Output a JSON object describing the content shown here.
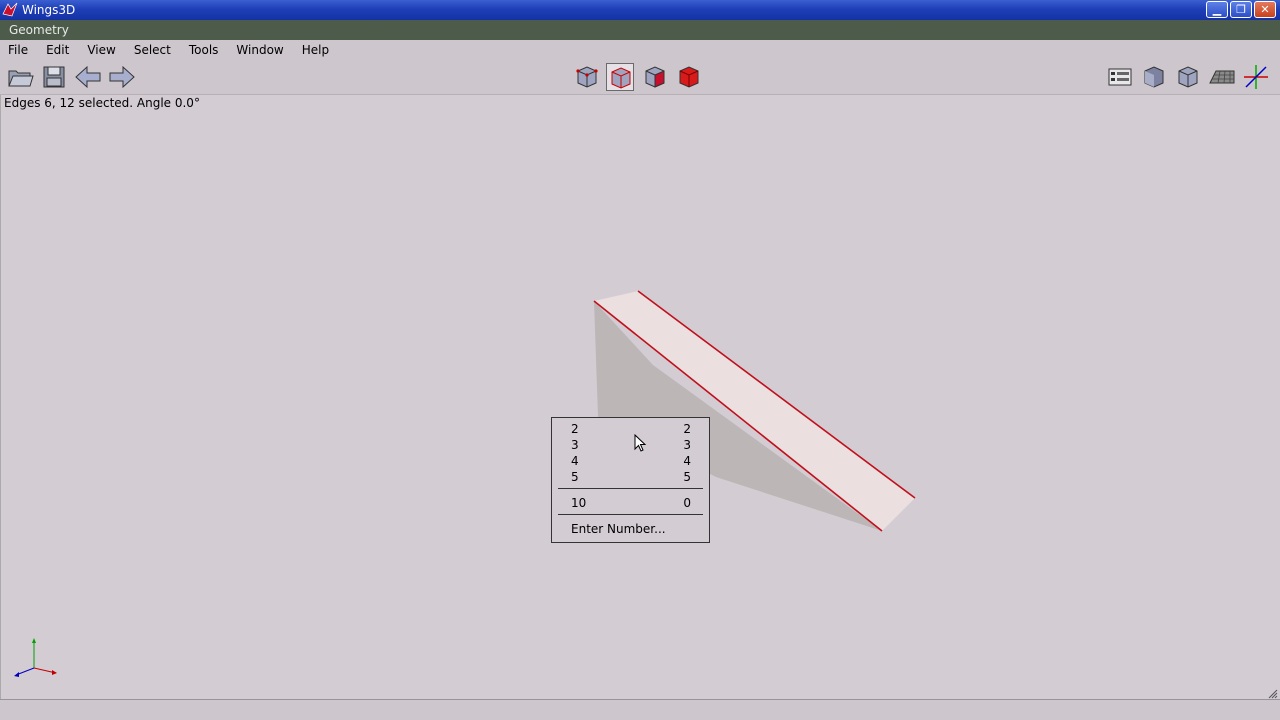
{
  "window": {
    "title": "Wings3D",
    "minimize": "▁",
    "restore": "❐",
    "close": "✕"
  },
  "geometry_header": "Geometry",
  "menu": [
    "File",
    "Edit",
    "View",
    "Select",
    "Tools",
    "Window",
    "Help"
  ],
  "status_message": "Edges 6, 12 selected. Angle 0.0°",
  "popup": {
    "rows": [
      {
        "left": "2",
        "right": "2"
      },
      {
        "left": "3",
        "right": "3"
      },
      {
        "left": "4",
        "right": "4"
      },
      {
        "left": "5",
        "right": "5"
      }
    ],
    "row_extra": {
      "left": "10",
      "right": "0"
    },
    "enter_number": "Enter Number..."
  },
  "colors": {
    "selected_edge": "#c0101c",
    "title_bar": "#1f3fb8",
    "viewport_bg": "#d3ccd3",
    "axis_x": "#c00000",
    "axis_y": "#00a000",
    "axis_z": "#0000c0"
  }
}
